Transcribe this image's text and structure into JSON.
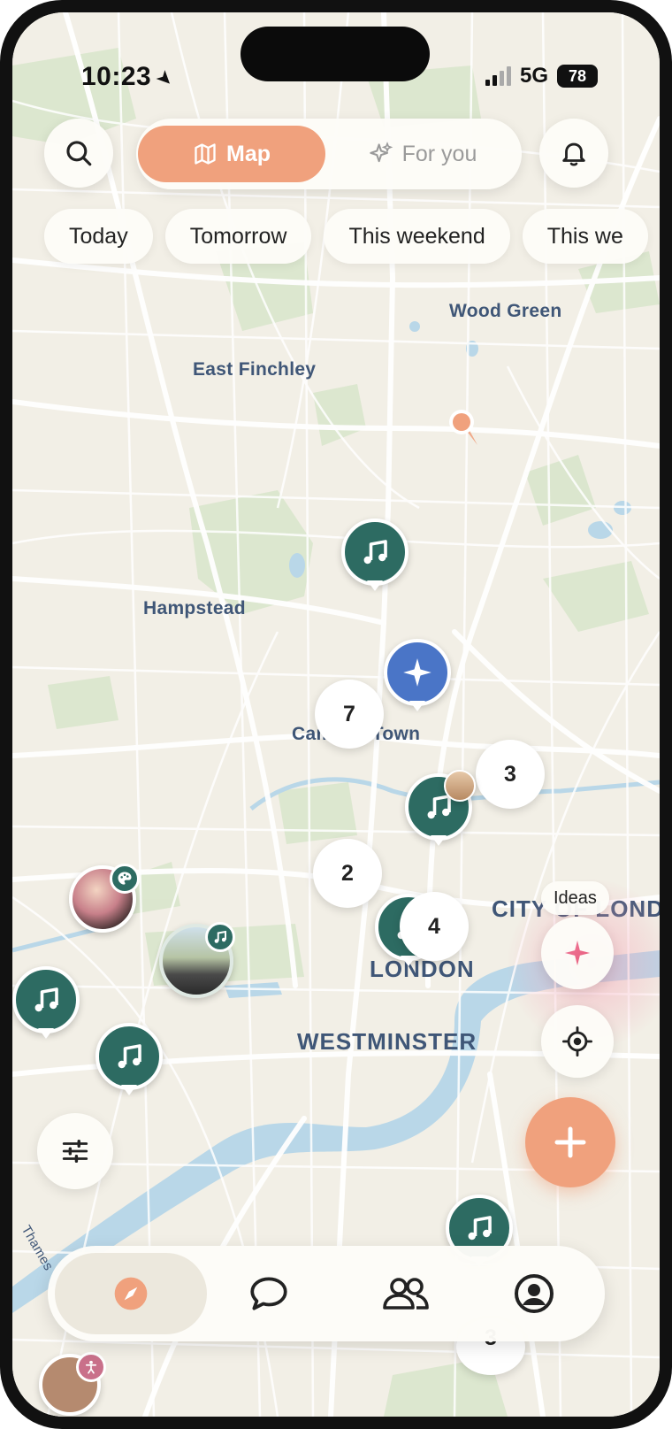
{
  "status": {
    "time": "10:23",
    "network": "5G",
    "battery": "78"
  },
  "header": {
    "tabs": [
      {
        "label": "Map",
        "icon": "map-icon",
        "active": true
      },
      {
        "label": "For you",
        "icon": "sparkles-icon",
        "active": false
      }
    ]
  },
  "filters": [
    "Today",
    "Tomorrow",
    "This weekend",
    "This we"
  ],
  "map": {
    "places": [
      "Wood Green",
      "East Finchley",
      "Hampstead",
      "Camden Town",
      "CITY OF LOND",
      "LONDON",
      "WESTMINSTER",
      "Thames"
    ],
    "clusters": [
      "7",
      "3",
      "2",
      "4",
      "3"
    ]
  },
  "controls": {
    "ideas_label": "Ideas"
  },
  "tabbar": [
    "explore-icon",
    "chat-icon",
    "people-icon",
    "profile-icon"
  ],
  "colors": {
    "accent": "#f0a17d",
    "pin": "#2d6b62",
    "blue_pin": "#4a75c7",
    "map_bg": "#f2efe6"
  }
}
